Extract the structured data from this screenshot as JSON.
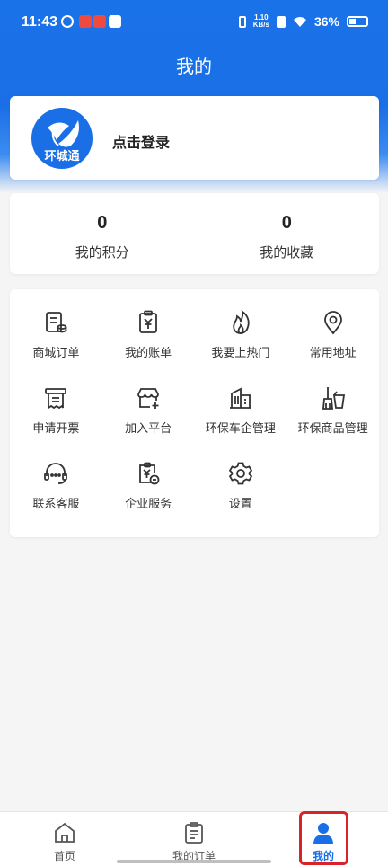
{
  "status_bar": {
    "time": "11:43",
    "speed": "1.10",
    "speed_unit": "KB/s",
    "battery": "36%"
  },
  "page_title": "我的",
  "profile": {
    "logo_text": "环城通",
    "login_label": "点击登录"
  },
  "stats": [
    {
      "value": "0",
      "label": "我的积分"
    },
    {
      "value": "0",
      "label": "我的收藏"
    }
  ],
  "menu": [
    {
      "label": "商城订单",
      "icon": "order-list-icon"
    },
    {
      "label": "我的账单",
      "icon": "bill-icon"
    },
    {
      "label": "我要上热门",
      "icon": "fire-icon"
    },
    {
      "label": "常用地址",
      "icon": "location-icon"
    },
    {
      "label": "申请开票",
      "icon": "invoice-icon"
    },
    {
      "label": "加入平台",
      "icon": "store-add-icon"
    },
    {
      "label": "环保车企管理",
      "icon": "building-icon"
    },
    {
      "label": "环保商品管理",
      "icon": "cleaning-icon"
    },
    {
      "label": "联系客服",
      "icon": "headset-icon"
    },
    {
      "label": "企业服务",
      "icon": "enterprise-icon"
    },
    {
      "label": "设置",
      "icon": "gear-icon"
    }
  ],
  "tabs": [
    {
      "label": "首页",
      "icon": "home-icon"
    },
    {
      "label": "我的订单",
      "icon": "clipboard-icon"
    },
    {
      "label": "我的",
      "icon": "user-icon"
    }
  ],
  "colors": {
    "brand": "#1a6fe6",
    "highlight": "#d9232a"
  }
}
